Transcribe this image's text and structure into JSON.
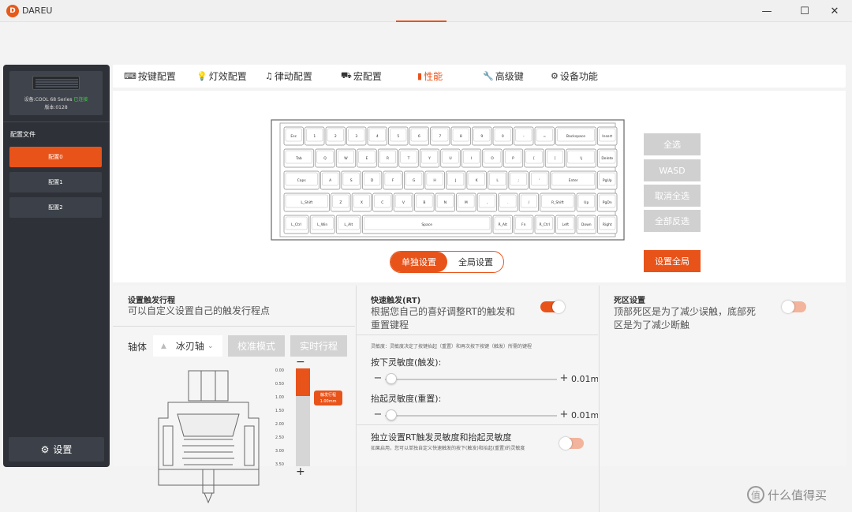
{
  "app": {
    "title": "DAREU",
    "logo_letter": "D"
  },
  "window_controls": {
    "minimize": "—",
    "maximize": "☐",
    "close": "✕"
  },
  "sidebar": {
    "device_name": "设备:COOL 68 Series",
    "device_status": "已连接",
    "device_version": "版本:0128",
    "profiles_title": "配置文件",
    "profiles": [
      {
        "label": "配置0",
        "active": true
      },
      {
        "label": "配置1",
        "active": false
      },
      {
        "label": "配置2",
        "active": false
      }
    ],
    "settings_label": "设置"
  },
  "tabs": [
    {
      "icon": "⌨",
      "label": "按键配置",
      "active": false
    },
    {
      "icon": "💡",
      "label": "灯效配置",
      "active": false
    },
    {
      "icon": "♫",
      "label": "律动配置",
      "active": false
    },
    {
      "icon": "⛟",
      "label": "宏配置",
      "active": false
    },
    {
      "icon": "▮",
      "label": "性能",
      "active": true
    },
    {
      "icon": "🔧",
      "label": "高级键",
      "active": false
    },
    {
      "icon": "⚙",
      "label": "设备功能",
      "active": false
    }
  ],
  "keyboard": {
    "rows": [
      [
        "Esc",
        "1",
        "2",
        "3",
        "4",
        "5",
        "6",
        "7",
        "8",
        "9",
        "0",
        "-",
        "=",
        "Backspace",
        "Insert"
      ],
      [
        "Tab",
        "Q",
        "W",
        "E",
        "R",
        "T",
        "Y",
        "U",
        "I",
        "O",
        "P",
        "[",
        "]",
        "\\|",
        "Delete"
      ],
      [
        "Caps",
        "A",
        "S",
        "D",
        "F",
        "G",
        "H",
        "J",
        "K",
        "L",
        ";",
        "'",
        "Enter",
        "PgUp"
      ],
      [
        "L_Shift",
        "Z",
        "X",
        "C",
        "V",
        "B",
        "N",
        "M",
        ",",
        ".",
        "/",
        "R_Shift",
        "Up",
        "PgDn"
      ],
      [
        "L_Ctrl",
        "L_Win",
        "L_Alt",
        "Space",
        "R_Alt",
        "Fn",
        "R_Ctrl",
        "Left",
        "Down",
        "Right"
      ]
    ]
  },
  "selection_buttons": {
    "select_all": "全选",
    "wasd": "WASD",
    "deselect_all": "取消全选",
    "invert": "全部反选",
    "apply_all": "设置全局"
  },
  "mode_toggle": {
    "single": "单独设置",
    "global": "全局设置"
  },
  "trigger_panel": {
    "title": "设置触发行程",
    "desc": "可以自定义设置自己的触发行程点",
    "axis_label": "轴体",
    "axis_value": "冰刃轴",
    "calibrate_label": "校准模式",
    "realtime_label": "实时行程",
    "scale_ticks": [
      "0.00",
      "0.50",
      "1.00",
      "1.50",
      "2.00",
      "2.50",
      "3.00",
      "3.50"
    ],
    "badge_title": "触发行程",
    "badge_value": "1.00mm",
    "travel_value": 1.0,
    "travel_max": 3.5,
    "minus": "−",
    "plus": "+"
  },
  "rt_panel": {
    "title": "快速触发(RT)",
    "desc_line1": "根据您自己的喜好调整RT的触发和",
    "desc_line2": "重置键程",
    "switch_on": true,
    "sensitivity_note": "灵敏度：灵敏度决定了按键抬起（重置）和再次按下按键（触发）所需的键程",
    "press_label": "按下灵敏度(触发):",
    "press_value": "0.01mm",
    "release_label": "抬起灵敏度(重置):",
    "release_value": "0.01mm",
    "independent_title": "独立设置RT触发灵敏度和抬起灵敏度",
    "independent_note": "如果启用，您可以单独自定义快速触发的按下(触发)和抬起(重置)的灵敏度",
    "independent_on": false,
    "minus": "−",
    "plus": "+"
  },
  "deadzone_panel": {
    "title": "死区设置",
    "desc_line1": "顶部死区是为了减少误触，底部死",
    "desc_line2": "区是为了减少断触",
    "switch_on": false
  },
  "watermark": {
    "logo": "值",
    "text": "什么值得买"
  },
  "colors": {
    "accent": "#e8531a",
    "sidebar": "#2e3138",
    "disabled": "#d0d0d0"
  }
}
